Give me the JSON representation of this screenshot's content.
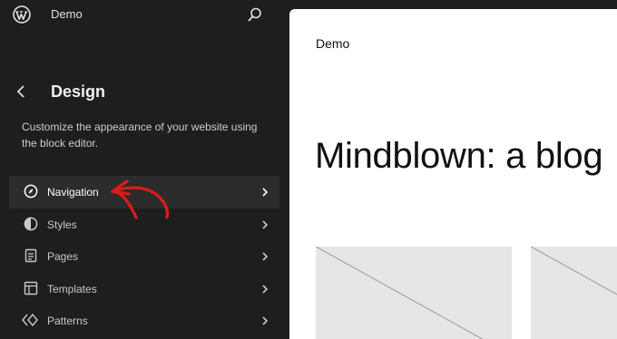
{
  "header": {
    "site_name": "Demo"
  },
  "sidebar": {
    "title": "Design",
    "description": "Customize the appearance of your website using the block editor.",
    "items": [
      {
        "label": "Navigation",
        "icon": "compass-icon",
        "active": true
      },
      {
        "label": "Styles",
        "icon": "half-circle-icon",
        "active": false
      },
      {
        "label": "Pages",
        "icon": "page-icon",
        "active": false
      },
      {
        "label": "Templates",
        "icon": "layout-icon",
        "active": false
      },
      {
        "label": "Patterns",
        "icon": "diamond-icon",
        "active": false
      }
    ]
  },
  "canvas": {
    "site_title": "Demo",
    "heading": "Mindblown: a blog"
  },
  "colors": {
    "sidebar_bg": "#1e1e1e",
    "active_item_bg": "#2c2c2c",
    "annotation_red": "#e01a1a",
    "placeholder_bg": "#e6e6e6"
  }
}
